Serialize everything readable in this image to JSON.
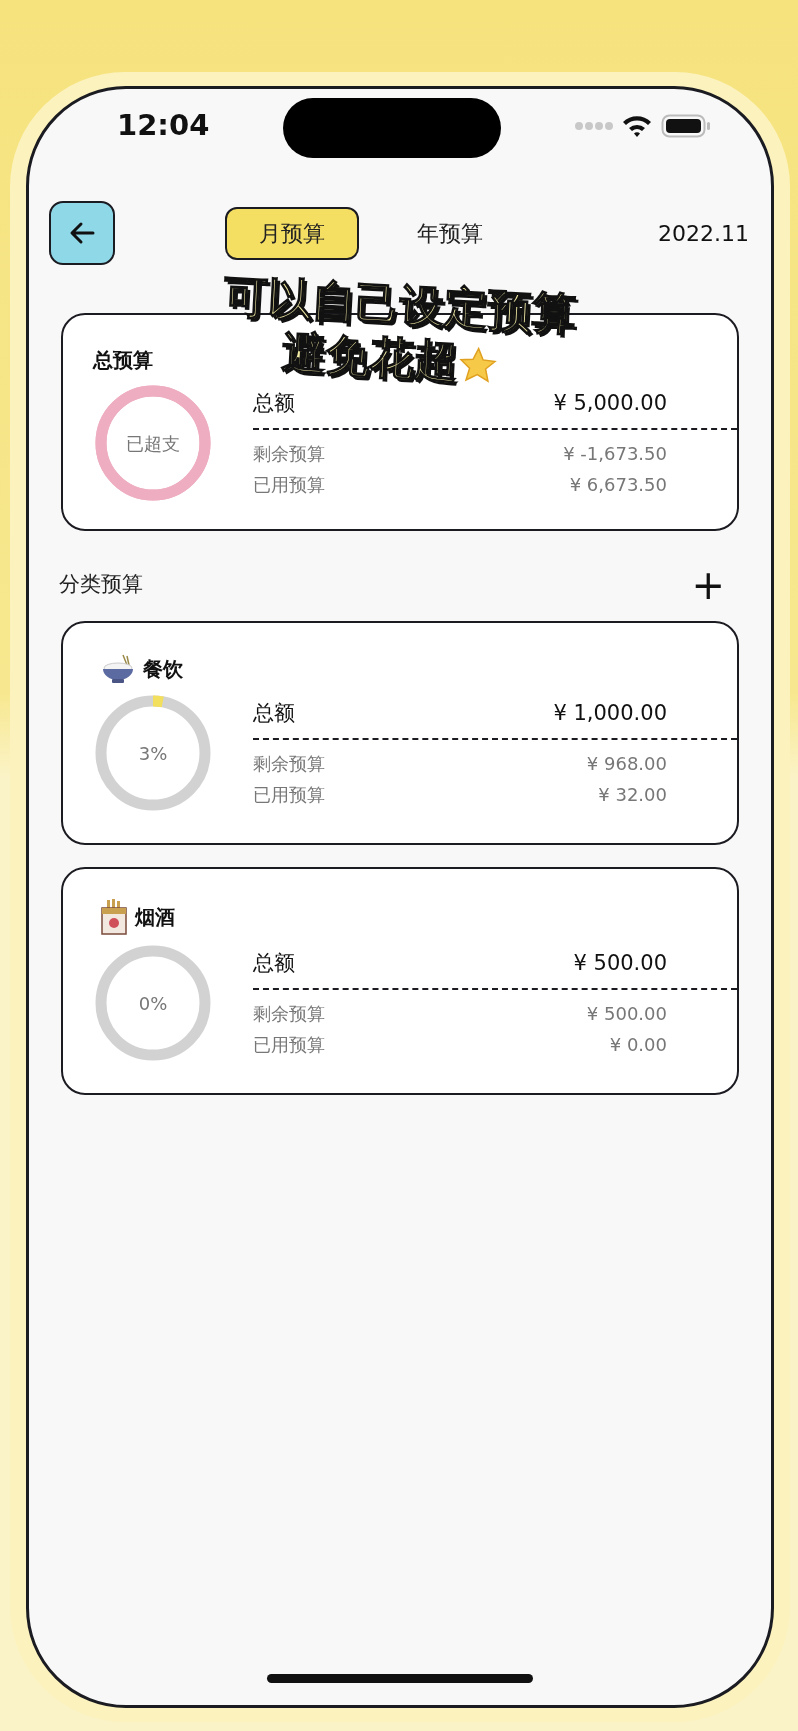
{
  "status_bar": {
    "time": "12:04"
  },
  "header": {
    "tabs": [
      {
        "label": "月预算",
        "selected": true
      },
      {
        "label": "年预算",
        "selected": false
      }
    ],
    "period": "2022.11"
  },
  "caption": {
    "lines": [
      "可以自己设定预算",
      "避免花超"
    ]
  },
  "total_budget": {
    "title": "总预算",
    "ring": {
      "label": "已超支",
      "overspent": true
    },
    "amount_label": "总额",
    "amount": "¥ 5,000.00",
    "rows": [
      {
        "label": "剩余预算",
        "value": "¥ -1,673.50"
      },
      {
        "label": "已用预算",
        "value": "¥ 6,673.50"
      }
    ]
  },
  "category_section": {
    "title": "分类预算",
    "add_button": "+"
  },
  "categories": [
    {
      "name": "餐饮",
      "kind": "food",
      "ring": {
        "label": "3%",
        "started": true,
        "overspent": false
      },
      "amount_label": "总额",
      "amount": "¥ 1,000.00",
      "rows": [
        {
          "label": "剩余预算",
          "value": "¥ 968.00"
        },
        {
          "label": "已用预算",
          "value": "¥ 32.00"
        }
      ]
    },
    {
      "name": "烟酒",
      "kind": "tobacco",
      "ring": {
        "label": "0%",
        "started": false,
        "overspent": false
      },
      "amount_label": "总额",
      "amount": "¥ 500.00",
      "rows": [
        {
          "label": "剩余预算",
          "value": "¥ 500.00"
        },
        {
          "label": "已用预算",
          "value": "¥ 0.00"
        }
      ]
    }
  ]
}
